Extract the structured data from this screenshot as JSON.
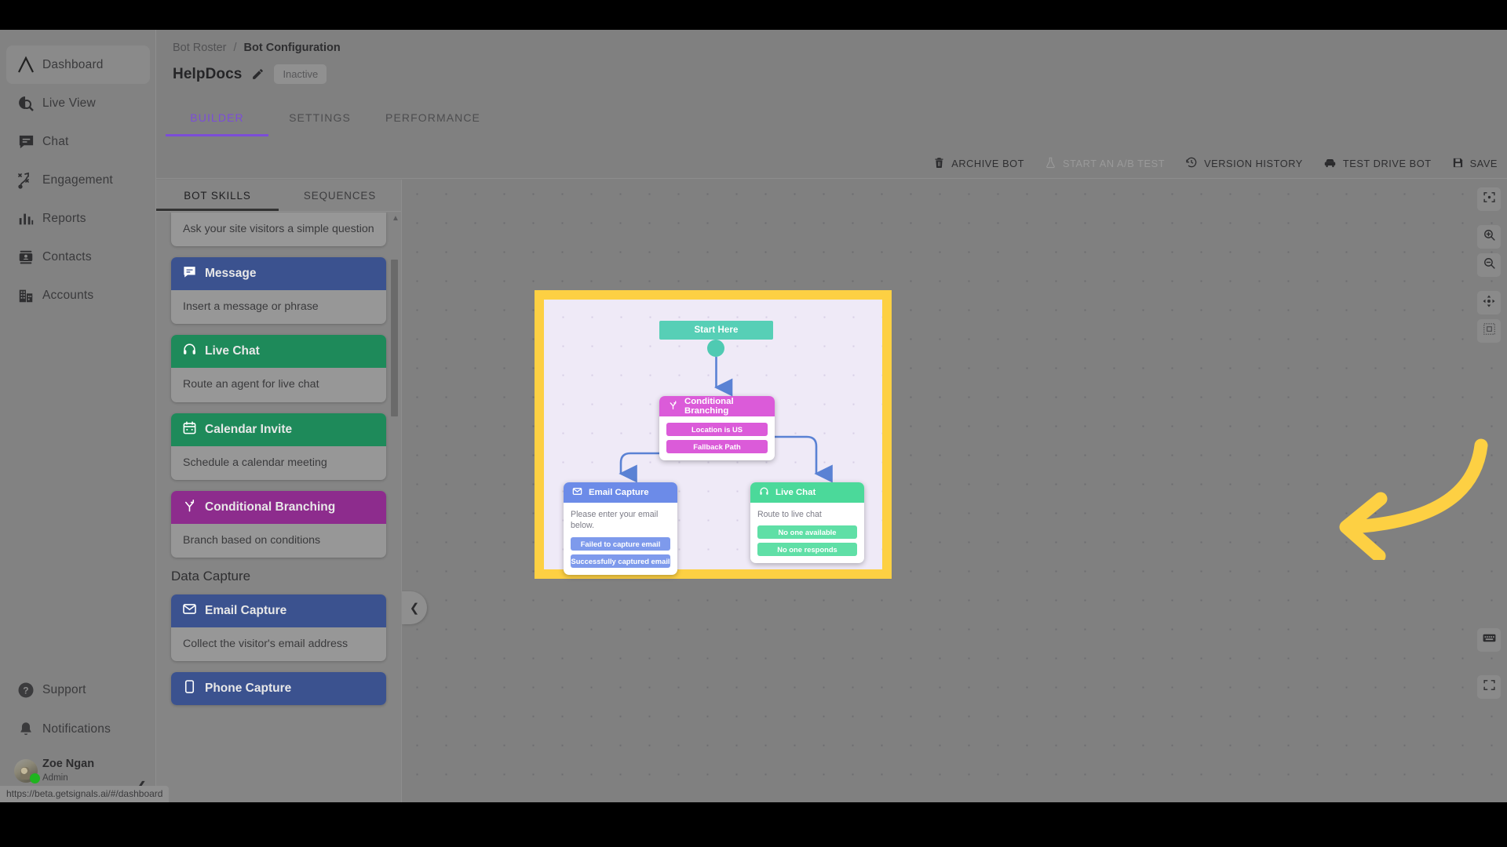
{
  "sidebar": {
    "items": [
      {
        "label": "Dashboard",
        "icon": "logo-peak-icon",
        "active": true
      },
      {
        "label": "Live View",
        "icon": "live-view-icon",
        "active": false
      },
      {
        "label": "Chat",
        "icon": "chat-bubble-icon",
        "active": false
      },
      {
        "label": "Engagement",
        "icon": "engagement-flow-icon",
        "active": false
      },
      {
        "label": "Reports",
        "icon": "bar-chart-icon",
        "active": false
      },
      {
        "label": "Contacts",
        "icon": "contact-card-icon",
        "active": false
      },
      {
        "label": "Accounts",
        "icon": "building-icon",
        "active": false
      }
    ],
    "bottom_items": [
      {
        "label": "Support",
        "icon": "question-circle-icon"
      },
      {
        "label": "Notifications",
        "icon": "bell-icon"
      }
    ],
    "user": {
      "name": "Zoe Ngan",
      "role": "Admin",
      "presence": "online",
      "presence_color": "#1fb41f"
    }
  },
  "header": {
    "breadcrumb": {
      "parent": "Bot Roster",
      "separator": "/",
      "current": "Bot Configuration"
    },
    "bot_name": "HelpDocs",
    "edit_icon": "pencil-icon",
    "status": "Inactive",
    "tabs": [
      {
        "label": "BUILDER",
        "selected": true
      },
      {
        "label": "SETTINGS",
        "selected": false
      },
      {
        "label": "PERFORMANCE",
        "selected": false
      }
    ],
    "accent_color": "#7b4dd8"
  },
  "toolbar": {
    "buttons": [
      {
        "label": "ARCHIVE BOT",
        "icon": "trash-icon",
        "disabled": false
      },
      {
        "label": "START AN A/B TEST",
        "icon": "flask-icon",
        "disabled": true
      },
      {
        "label": "VERSION HISTORY",
        "icon": "history-clock-icon",
        "disabled": false
      },
      {
        "label": "TEST DRIVE BOT",
        "icon": "car-icon",
        "disabled": false
      },
      {
        "label": "SAVE",
        "icon": "floppy-disk-icon",
        "disabled": false
      }
    ]
  },
  "skills_panel": {
    "tabs": [
      {
        "label": "BOT SKILLS",
        "selected": true
      },
      {
        "label": "SEQUENCES",
        "selected": false
      }
    ],
    "partial_card_text": "Ask your site visitors a simple question",
    "cards": [
      {
        "title": "Message",
        "desc": "Insert a message or phrase",
        "icon": "chat-bubble-icon",
        "color": "#3B528F"
      },
      {
        "title": "Live Chat",
        "desc": "Route an agent for live chat",
        "icon": "headset-icon",
        "color": "#1E8A5A"
      },
      {
        "title": "Calendar Invite",
        "desc": "Schedule a calendar meeting",
        "icon": "calendar-icon",
        "color": "#1E8A5A"
      },
      {
        "title": "Conditional Branching",
        "desc": "Branch based on conditions",
        "icon": "branch-icon",
        "color": "#8D2C8D"
      }
    ],
    "section_label": "Data Capture",
    "data_cards": [
      {
        "title": "Email Capture",
        "desc": "Collect the visitor's email address",
        "icon": "envelope-icon",
        "color": "#3B528F"
      },
      {
        "title": "Phone Capture",
        "desc": "",
        "icon": "phone-icon",
        "color": "#3B528F"
      }
    ],
    "collapse_icon": "chevron-left-icon"
  },
  "canvas": {
    "highlight_border_color": "#FDD043",
    "background_color": "#EFEAF7",
    "annotation_arrow": {
      "icon": "curved-left-arrow",
      "color": "#FDD043"
    },
    "nodes": [
      {
        "id": "start",
        "title": "Start Here",
        "type": "start",
        "color": "#57CFB6"
      },
      {
        "id": "branch",
        "title": "Conditional Branching",
        "icon": "branch-icon",
        "color": "#DB5BD9",
        "options": [
          "Location is US",
          "Fallback Path"
        ]
      },
      {
        "id": "email",
        "title": "Email Capture",
        "icon": "envelope-icon",
        "color": "#6C8BE8",
        "body_text": "Please enter your email below.",
        "options": [
          "Failed to capture email",
          "Successfully captured email"
        ]
      },
      {
        "id": "livechat",
        "title": "Live Chat",
        "icon": "headset-icon",
        "color": "#4BD99A",
        "body_text": "Route to live chat",
        "options": [
          "No one available",
          "No one responds"
        ]
      }
    ]
  },
  "rail": {
    "buttons": [
      {
        "icon": "fit-to-screen-icon",
        "name": "fit-view-button"
      },
      {
        "icon": "zoom-in-icon",
        "name": "zoom-in-button"
      },
      {
        "icon": "zoom-out-icon",
        "name": "zoom-out-button"
      },
      {
        "icon": "pan-move-icon",
        "name": "pan-button"
      },
      {
        "icon": "minimap-icon",
        "name": "minimap-button"
      },
      {
        "icon": "keyboard-icon",
        "name": "keyboard-shortcuts-button"
      },
      {
        "icon": "fullscreen-icon",
        "name": "fullscreen-button"
      }
    ]
  },
  "status_bar": {
    "url": "https://beta.getsignals.ai/#/dashboard"
  }
}
